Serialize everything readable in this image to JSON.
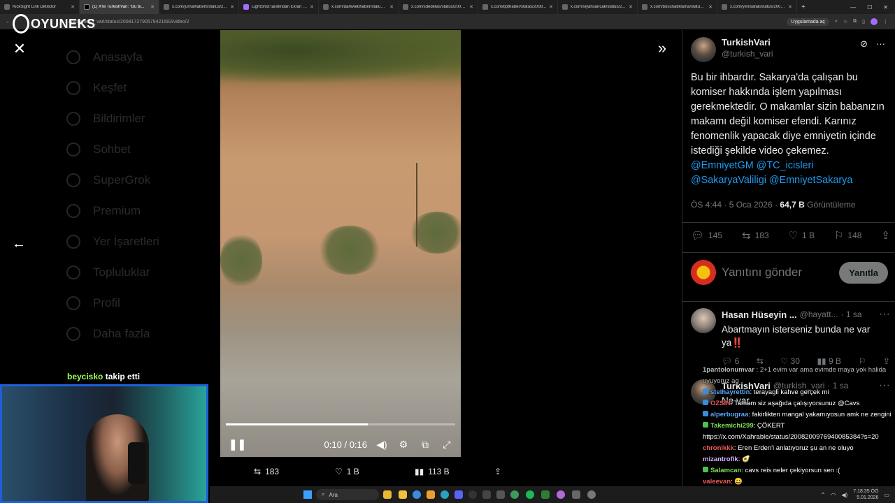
{
  "browser": {
    "tabs": [
      {
        "label": "KickSight Link Detector"
      },
      {
        "label": "(1) X'te TurkishVari: \"Bu bi..."
      },
      {
        "label": "x.com/jurnalhaberti/status/2..."
      },
      {
        "label": "LightShot tarafından Ekran G..."
      },
      {
        "label": "x.com/darkwebhaber/status/..."
      },
      {
        "label": "x.com/sdedetas/status/2008..."
      },
      {
        "label": "x.com/bpthaber/status/2008..."
      },
      {
        "label": "x.com/siyahsancak/status/2..."
      },
      {
        "label": "x.com/bosunatiklama/status/..."
      },
      {
        "label": "x.com/yenisafak/status/2007..."
      }
    ],
    "url": "x.com/turkish_vari/status/2008172790579421683/video/2",
    "app_button": "Uygulamada aç",
    "overlay_logo": "OYUNEKS"
  },
  "background_nav": [
    "Anasayfa",
    "Keşfet",
    "Bildirimler",
    "Sohbet",
    "SuperGrok",
    "Premium",
    "Yer İşaretleri",
    "Topluluklar",
    "Profil",
    "Daha fazla"
  ],
  "video": {
    "time_current": "0:10",
    "time_total": "0:16",
    "progress_fraction": 0.62,
    "repost_count": "183",
    "like_count": "1 B",
    "views_count": "113 B"
  },
  "tweet": {
    "author_name": "TurkishVari",
    "author_handle": "@turkish_vari",
    "text_part1": "Bu bir ihbardır. Sakarya'da çalışan bu komiser hakkında işlem yapılması gerekmektedir. O makamlar sizin babanızın makamı değil komiser efendi. Karınız fenomenlik yapacak diye emniyetin içinde istediği şekilde video çekemez. ",
    "mentions": [
      "@EmniyetGM",
      "@TC_icisleri",
      "@SakaryaValiligi",
      "@EmniyetSakarya"
    ],
    "timestamp": "ÖS 4:44 · 5 Oca 2026",
    "views_value": "64,7 B",
    "views_label": "Görüntüleme",
    "replies": "145",
    "reposts": "183",
    "likes": "1 B",
    "bookmarks": "148"
  },
  "reply_box": {
    "placeholder": "Yanıtını gönder",
    "button": "Yanıtla"
  },
  "comments": [
    {
      "name": "Hasan Hüseyin ...",
      "handle": "@hayatt...",
      "time": "· 1 sa",
      "text": "Abartmayın isterseniz bunda ne var ya",
      "emoji": "‼️",
      "replies": "6",
      "likes": "30",
      "views": "9 B"
    },
    {
      "name": "TurkishVari",
      "handle": "@turkish_vari",
      "time": "· 1 sa",
      "text": "Ne var."
    }
  ],
  "chat": [
    {
      "user": "1pantolonumvar",
      "msg": ": 2+1 evim var ama evimde maya yok halida uyuyoruz ag"
    },
    {
      "user": "stelhayrettin",
      "msg": ": terayagli kahve gerçek mi"
    },
    {
      "user": "OZSIN",
      "msg": ": Tamam siz aşağıda çalışıyorsunuz @Cavs"
    },
    {
      "user": "alperbugraa",
      "msg": ": fakirlikten mangal yakamıyosun amk ne zengini"
    },
    {
      "user": "Takemichi299",
      "msg": ": ÇÖKERT"
    },
    {
      "user": "https://x.com/Xahrable/status/2008200976940085384?s=20",
      "msg": ""
    },
    {
      "user": "chronikkk",
      "msg": ": Eren Erden'i anlatıyoruz şu an ne oluyo"
    },
    {
      "user": "mizantrofik",
      "msg": ": 🥑"
    },
    {
      "user": "Salamcan",
      "msg": ": cavs reis neler çekiyorsun sen :("
    },
    {
      "user": "valeevan",
      "msg": ": 😀"
    }
  ],
  "follow_alert": {
    "name": "beycisko",
    "action": "takip etti"
  },
  "taskbar": {
    "search_placeholder": "Ara",
    "time": "7:18:35 ÖÖ",
    "date": "5.01.2026"
  }
}
